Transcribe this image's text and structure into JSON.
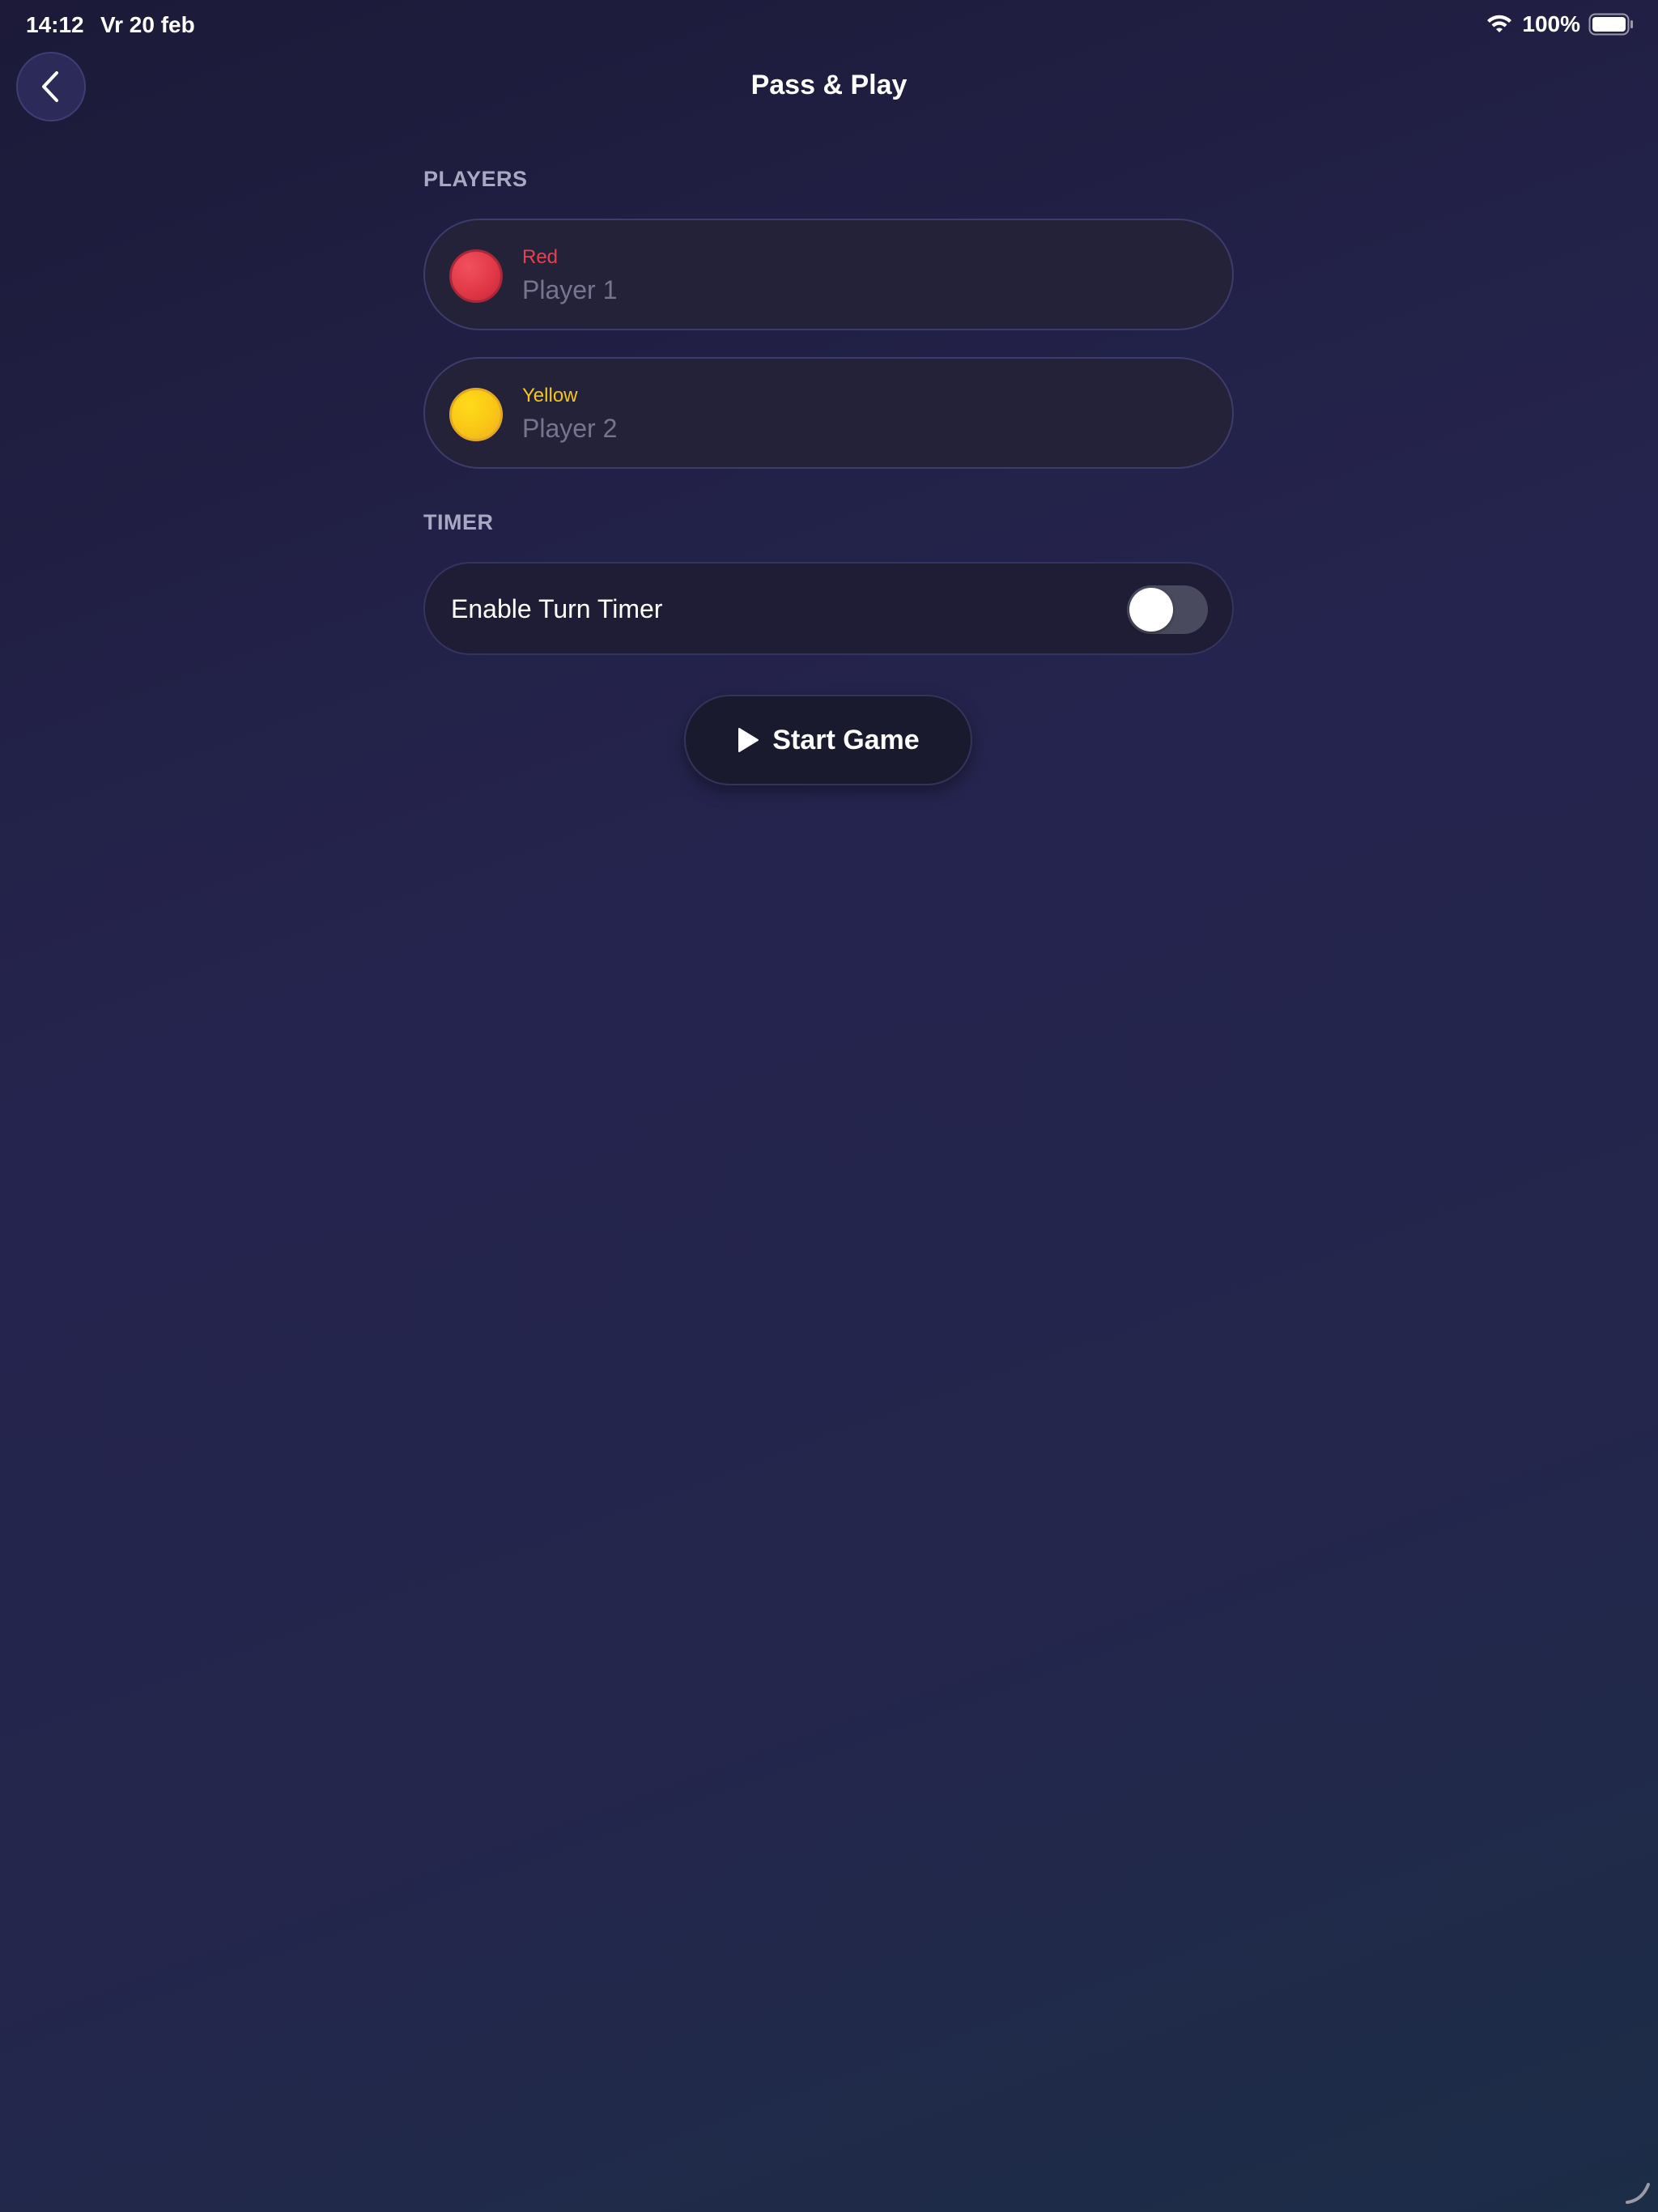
{
  "status_bar": {
    "time": "14:12",
    "date": "Vr 20 feb",
    "battery_percent": "100%",
    "battery_level": 1.0
  },
  "header": {
    "title": "Pass & Play",
    "back_icon": "chevron-left-icon"
  },
  "players_section": {
    "label": "PLAYERS",
    "players": [
      {
        "color_label": "Red",
        "color_hex": "#e8404d",
        "name_value": "",
        "name_placeholder": "Player 1"
      },
      {
        "color_label": "Yellow",
        "color_hex": "#f5c518",
        "name_value": "",
        "name_placeholder": "Player 2"
      }
    ]
  },
  "timer_section": {
    "label": "TIMER",
    "toggle_label": "Enable Turn Timer",
    "enabled": false
  },
  "start_button": {
    "label": "Start Game",
    "icon": "play-icon"
  },
  "colors": {
    "background": "#25244e",
    "card_background": "#232239",
    "card_border": "#3d3c6a",
    "section_label": "#a9a8c3",
    "placeholder_text": "#76758f",
    "toggle_off": "#4a4a5e"
  }
}
